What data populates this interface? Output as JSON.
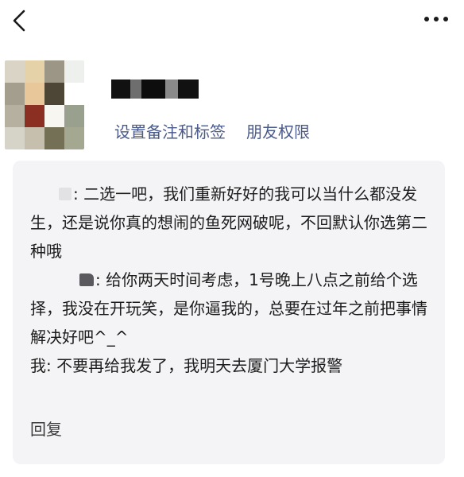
{
  "icons": {
    "back": "chevron-left-icon",
    "more": "more-horizontal-icon"
  },
  "colors": {
    "link": "#4a5a8a",
    "card_bg": "#f4f4f6"
  },
  "profile": {
    "name_redacted": true,
    "links": {
      "remark": "设置备注和标签",
      "permission": "朋友权限"
    }
  },
  "message": {
    "lines": [
      ": 二选一吧，我们重新好好的我可以当什么都没发生，还是说你真的想闹的鱼死网破呢，不回默认你选第二种哦",
      ": 给你两天时间考虑，1号晚上八点之前给个选择，我没在开玩笑，是你逼我的，总要在过年之前把事情解决好吧^_^",
      "我: 不要再给我发了，我明天去厦门大学报警"
    ],
    "reply_label": "回复"
  }
}
